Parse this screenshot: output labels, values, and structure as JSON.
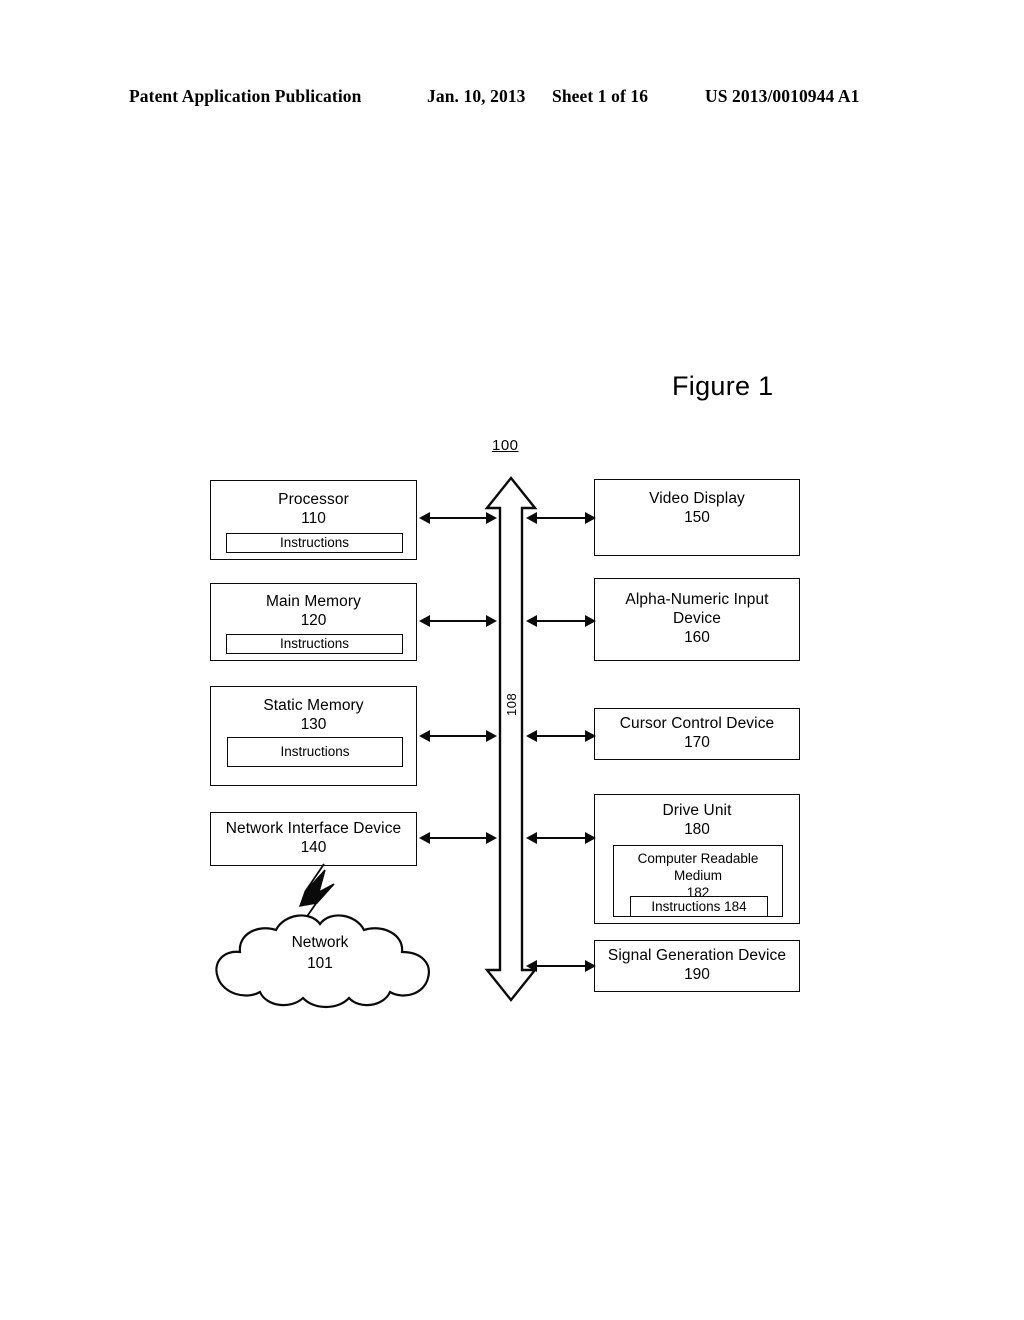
{
  "header": {
    "publication": "Patent Application Publication",
    "date": "Jan. 10, 2013",
    "sheet": "Sheet 1 of 16",
    "patent_number": "US 2013/0010944 A1"
  },
  "figure": {
    "title": "Figure 1",
    "system_ref": "100"
  },
  "bus": {
    "label": "108"
  },
  "left_nodes": [
    {
      "title": "Processor",
      "number": "110",
      "inner": {
        "label": "Instructions"
      }
    },
    {
      "title": "Main Memory",
      "number": "120",
      "inner": {
        "label": "Instructions"
      }
    },
    {
      "title": "Static Memory",
      "number": "130",
      "inner": {
        "label": "Instructions"
      }
    },
    {
      "title": "Network Interface Device",
      "number": "140"
    }
  ],
  "right_nodes": [
    {
      "title": "Video Display",
      "number": "150"
    },
    {
      "title": "Alpha-Numeric Input Device",
      "number": "160"
    },
    {
      "title": "Cursor Control Device",
      "number": "170"
    },
    {
      "title": "Drive Unit",
      "number": "180",
      "inner": {
        "title": "Computer Readable Medium",
        "number": "182",
        "inner": {
          "label": "Instructions 184"
        }
      }
    },
    {
      "title": "Signal Generation Device",
      "number": "190"
    }
  ],
  "network": {
    "title": "Network",
    "number": "101",
    "link_icon": "lightning-bolt-icon"
  },
  "colors": {
    "ink": "#0a0a0a",
    "background": "#ffffff"
  }
}
